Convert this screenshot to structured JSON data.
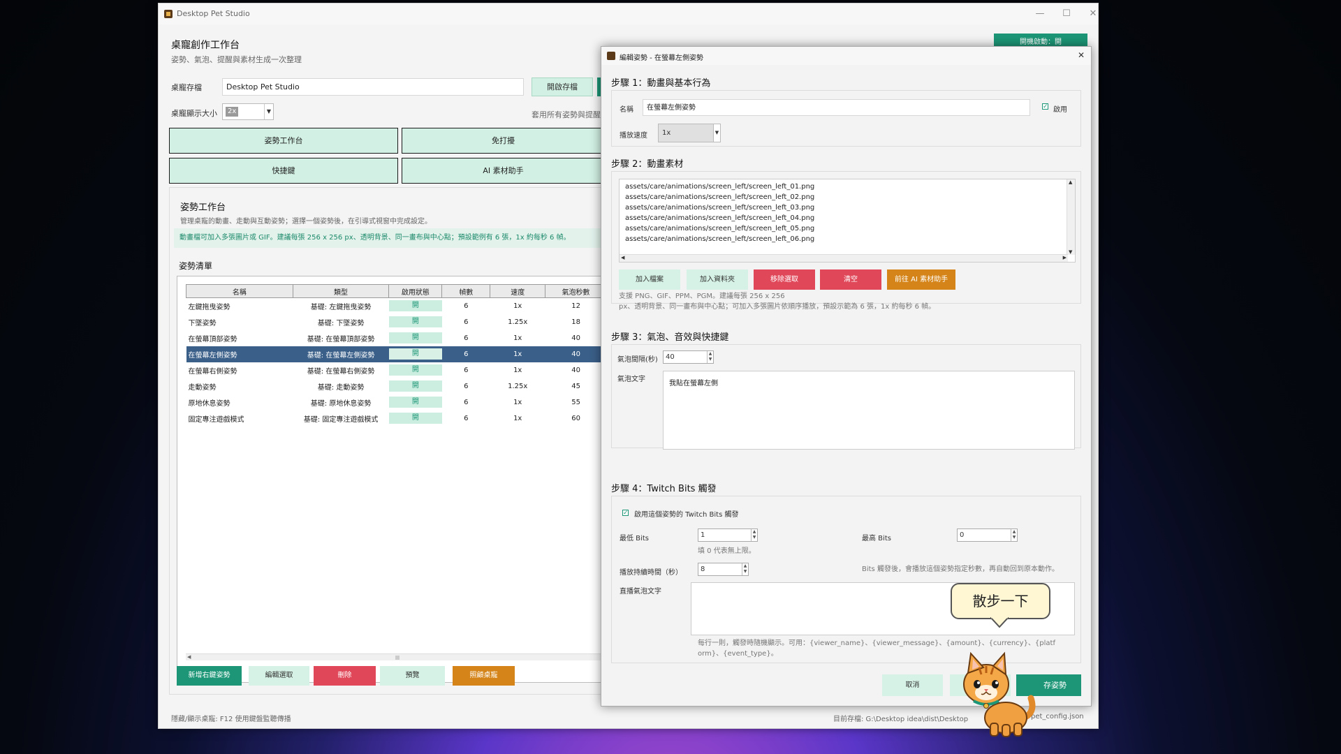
{
  "window": {
    "title": "Desktop Pet Studio",
    "minimize": "—",
    "maximize": "☐",
    "close": "✕"
  },
  "header": {
    "title": "桌寵創作工作台",
    "subtitle": "姿勢、氣泡、提醒與素材生成一次整理",
    "top_button": "開機啟動：開"
  },
  "profile": {
    "label": "桌寵存檔",
    "value": "Desktop Pet Studio",
    "open_button": "開啟存檔",
    "size_label": "桌寵顯示大小",
    "size_value": "2x",
    "apply_note": "套用所有姿勢與提醒"
  },
  "tiles": [
    "姿勢工作台",
    "免打擾",
    "快捷鍵",
    "AI 素材助手"
  ],
  "workbench": {
    "title": "姿勢工作台",
    "desc": "管理桌寵的動畫、走動與互動姿勢；選擇一個姿勢後，在引導式視窗中完成設定。",
    "tip": "動畫檔可加入多張圖片或 GIF。建議每張 256 x 256 px、透明背景、同一畫布與中心點；預設範例有 6 張，1x 約每秒 6 幀。",
    "list_title": "姿勢清單",
    "columns": [
      "名稱",
      "類型",
      "啟用狀態",
      "幀數",
      "速度",
      "氣泡秒數"
    ],
    "rows": [
      [
        "左鍵拖曳姿勢",
        "基礎: 左鍵拖曳姿勢",
        "開",
        "6",
        "1x",
        "12"
      ],
      [
        "下墜姿勢",
        "基礎: 下墜姿勢",
        "開",
        "6",
        "1.25x",
        "18"
      ],
      [
        "在螢幕頂部姿勢",
        "基礎: 在螢幕頂部姿勢",
        "開",
        "6",
        "1x",
        "40"
      ],
      [
        "在螢幕左側姿勢",
        "基礎: 在螢幕左側姿勢",
        "開",
        "6",
        "1x",
        "40"
      ],
      [
        "在螢幕右側姿勢",
        "基礎: 在螢幕右側姿勢",
        "開",
        "6",
        "1x",
        "40"
      ],
      [
        "走動姿勢",
        "基礎: 走動姿勢",
        "開",
        "6",
        "1.25x",
        "45"
      ],
      [
        "原地休息姿勢",
        "基礎: 原地休息姿勢",
        "開",
        "6",
        "1x",
        "55"
      ],
      [
        "固定專注遊戲模式",
        "基礎: 固定專注遊戲模式",
        "開",
        "6",
        "1x",
        "60"
      ]
    ],
    "selected_row": 3,
    "buttons": [
      "新增右鍵姿勢",
      "編輯選取",
      "刪除",
      "預覽",
      "照顧桌寵"
    ]
  },
  "footer": {
    "hint": "隱藏/顯示桌寵: F12 使用鍵盤監聽傳播",
    "path_left": "目前存檔: G:\\Desktop idea\\dist\\Desktop",
    "path_right": "pet_config.json"
  },
  "dialog": {
    "title": "編輯姿勢 - 在螢幕左側姿勢",
    "close": "✕",
    "step1": {
      "title": "步驟 1：動畫與基本行為",
      "name_label": "名稱",
      "name_value": "在螢幕左側姿勢",
      "enabled_label": "啟用",
      "speed_label": "播放速度",
      "speed_value": "1x"
    },
    "step2": {
      "title": "步驟 2：動畫素材",
      "files": [
        "assets/care/animations/screen_left/screen_left_01.png",
        "assets/care/animations/screen_left/screen_left_02.png",
        "assets/care/animations/screen_left/screen_left_03.png",
        "assets/care/animations/screen_left/screen_left_04.png",
        "assets/care/animations/screen_left/screen_left_05.png",
        "assets/care/animations/screen_left/screen_left_06.png"
      ],
      "buttons": [
        "加入檔案",
        "加入資料夾",
        "移除選取",
        "清空",
        "前往 AI 素材助手"
      ],
      "hint1": "支援 PNG、GIF、PPM、PGM。建議每張 256 x 256",
      "hint2": "px、透明背景、同一畫布與中心點；可加入多張圖片依順序播放，預設示範為 6 張，1x 約每秒 6 幀。"
    },
    "step3": {
      "title": "步驟 3：氣泡、音效與快捷鍵",
      "interval_label": "氣泡間隔(秒)",
      "interval_value": "40",
      "text_label": "氣泡文字",
      "text_value": "我貼在螢幕左側"
    },
    "step4": {
      "title": "步驟 4：Twitch Bits 觸發",
      "enable_label": "啟用這個姿勢的 Twitch Bits 觸發",
      "min_label": "最低 Bits",
      "min_value": "1",
      "max_label": "最高 Bits",
      "max_value": "0",
      "zero_hint": "填 0 代表無上限。",
      "duration_label": "播放持續時間（秒）",
      "duration_value": "8",
      "duration_hint": "Bits 觸發後，會播放這個姿勢指定秒數，再自動回到原本動作。",
      "stream_label": "直播氣泡文字",
      "stream_hint1": "每行一則，觸發時隨機顯示。可用：{viewer_name}、{viewer_message}、{amount}、{currency}、{platf",
      "stream_hint2": "orm}、{event_type}。"
    },
    "cancel": "取消",
    "save": "存姿勢"
  },
  "pet": {
    "bubble": "散步一下"
  },
  "colors": {
    "accent": "#1c9676",
    "danger": "#e0485a",
    "warning": "#d48418",
    "selected_row": "#3a5f88"
  }
}
